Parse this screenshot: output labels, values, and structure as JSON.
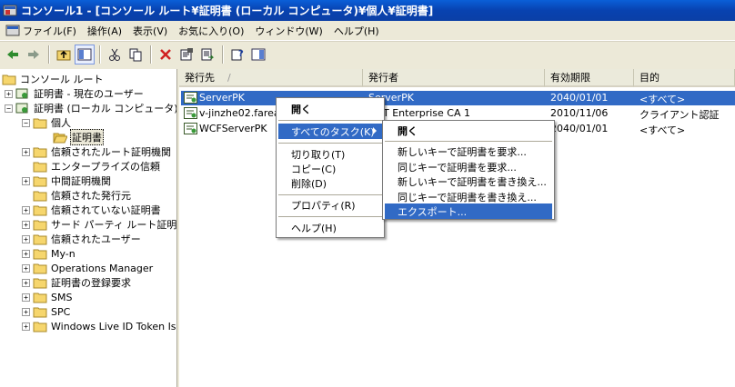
{
  "window": {
    "title": "コンソール1 - [コンソール ルート¥証明書 (ローカル コンピュータ)¥個人¥証明書]"
  },
  "menubar": [
    "ファイル(F)",
    "操作(A)",
    "表示(V)",
    "お気に入り(O)",
    "ウィンドウ(W)",
    "ヘルプ(H)"
  ],
  "toolbar": {
    "buttons": [
      "back-icon",
      "forward-icon",
      "up-folder-icon",
      "show-hide-tree-icon",
      "cut-icon",
      "copy-icon",
      "delete-icon",
      "properties-icon",
      "export-list-icon",
      "help-icon",
      "action-pane-icon"
    ]
  },
  "tree": {
    "items": [
      "コンソール ルート",
      "証明書 - 現在のユーザー",
      "証明書 (ローカル コンピュータ)",
      "個人",
      "証明書",
      "信頼されたルート証明機関",
      "エンタープライズの信頼",
      "中間証明機関",
      "信頼された発行元",
      "信頼されていない証明書",
      "サード パーティ ルート証明機",
      "信頼されたユーザー",
      "My-n",
      "Operations Manager",
      "証明書の登録要求",
      "SMS",
      "SPC",
      "Windows Live ID Token Is"
    ]
  },
  "list": {
    "columns": [
      "発行先",
      "発行者",
      "有効期限",
      "目的"
    ],
    "sort_indicator": "/",
    "rows": [
      {
        "issued_to": "ServerPK",
        "issued_by": "ServerPK",
        "expires": "2040/01/01",
        "purpose": "<すべて>"
      },
      {
        "issued_to": "v-jinzhe02.fareas",
        "issued_by": "T Enterprise CA 1",
        "expires": "2010/11/06",
        "purpose": "クライアント認証"
      },
      {
        "issued_to": "WCFServerPK",
        "issued_by": "",
        "expires": "2040/01/01",
        "purpose": "<すべて>"
      }
    ]
  },
  "context_menu": {
    "open": "開く",
    "all_tasks": "すべてのタスク(K)",
    "cut": "切り取り(T)",
    "copy": "コピー(C)",
    "delete": "削除(D)",
    "properties": "プロパティ(R)",
    "help": "ヘルプ(H)"
  },
  "submenu": {
    "open": "開く",
    "req_new_key": "新しいキーで証明書を要求...",
    "req_same_key": "同じキーで証明書を要求...",
    "renew_new_key": "新しいキーで証明書を書き換え...",
    "renew_same_key": "同じキーで証明書を書き換え...",
    "export": "エクスポート..."
  },
  "colors": {
    "titlebar": "#0842b0",
    "selection": "#316ac5",
    "chrome": "#ece9d8"
  }
}
